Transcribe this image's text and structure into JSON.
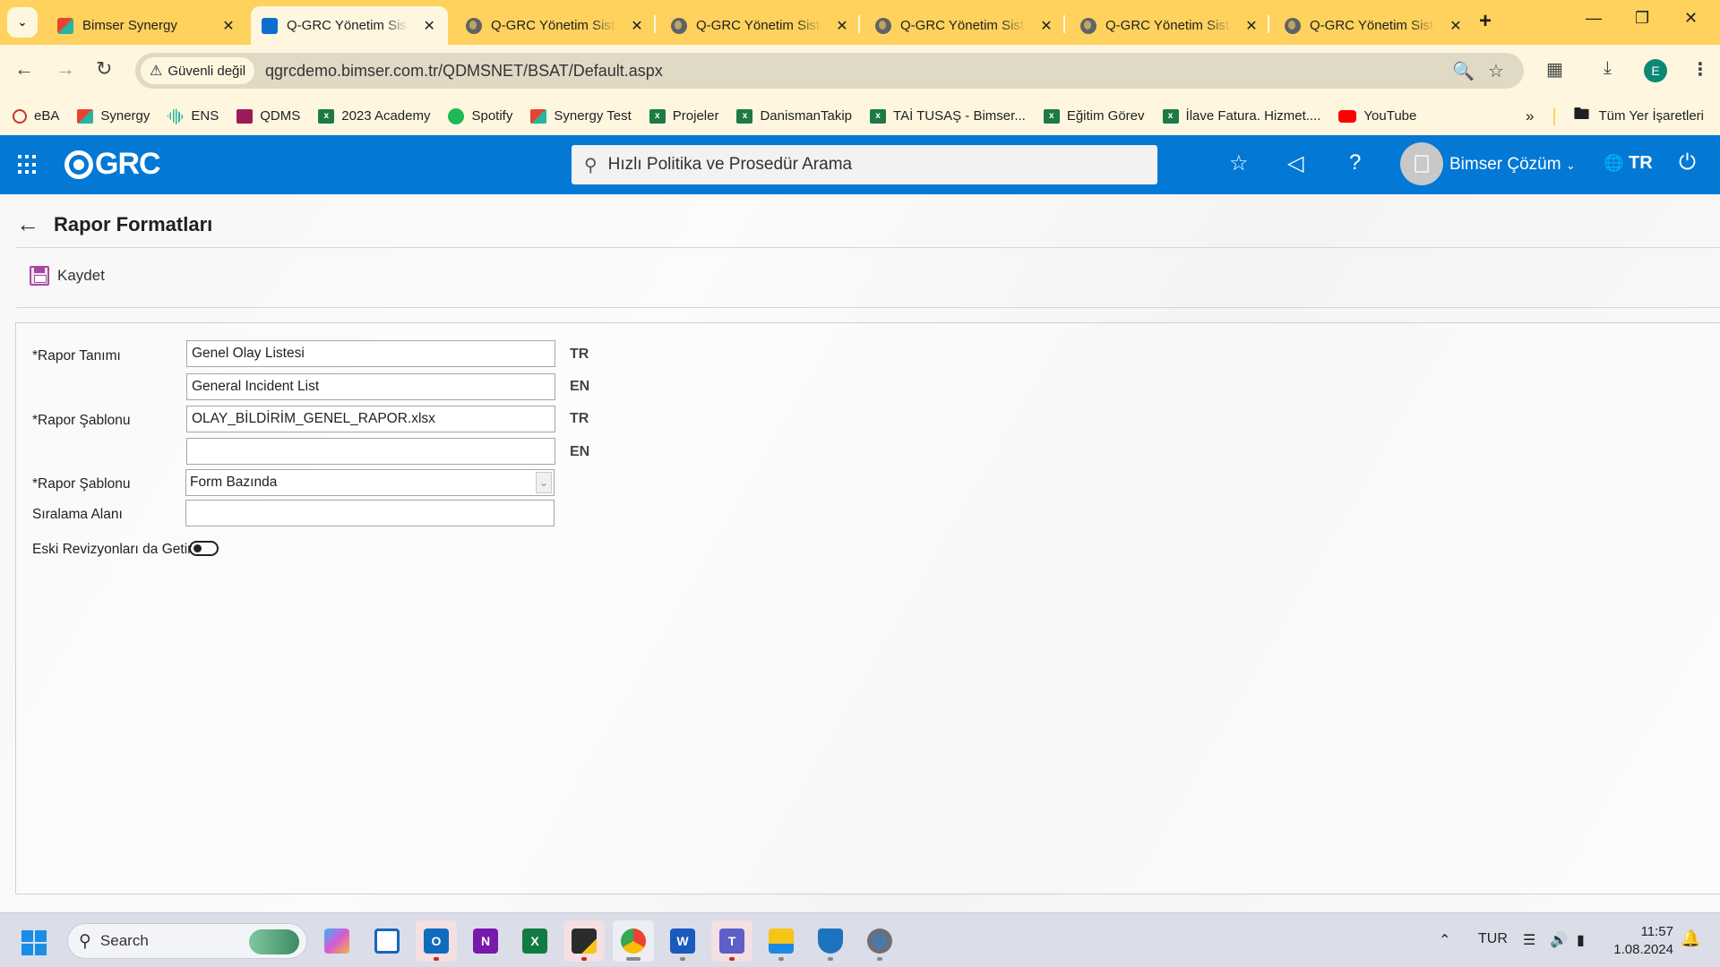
{
  "browser": {
    "tabs": [
      {
        "title": "Bimser Synergy",
        "active": false,
        "icon": "synergy-icon"
      },
      {
        "title": "Q-GRC Yönetim Sistemi",
        "active": true,
        "icon": "qgrc-icon"
      },
      {
        "title": "Q-GRC Yönetim Sistemi",
        "active": false,
        "icon": "globe-icon"
      },
      {
        "title": "Q-GRC Yönetim Sistemi",
        "active": false,
        "icon": "globe-icon"
      },
      {
        "title": "Q-GRC Yönetim Sistemi",
        "active": false,
        "icon": "globe-icon"
      },
      {
        "title": "Q-GRC Yönetim Sistemi",
        "active": false,
        "icon": "globe-icon"
      },
      {
        "title": "Q-GRC Yönetim Sistemi",
        "active": false,
        "icon": "globe-icon"
      }
    ],
    "security_chip": "Güvenli değil",
    "url": "qgrcdemo.bimser.com.tr/QDMSNET/BSAT/Default.aspx",
    "profile_initial": "E",
    "bookmarks": [
      {
        "label": "eBA",
        "icon": "eba-icon"
      },
      {
        "label": "Synergy",
        "icon": "synergy-icon"
      },
      {
        "label": "ENS",
        "icon": "ens-icon"
      },
      {
        "label": "QDMS",
        "icon": "qdms-icon"
      },
      {
        "label": "2023 Academy",
        "icon": "excel-icon"
      },
      {
        "label": "Spotify",
        "icon": "spotify-icon"
      },
      {
        "label": "Synergy Test",
        "icon": "synergy-icon"
      },
      {
        "label": "Projeler",
        "icon": "excel-icon"
      },
      {
        "label": "DanismanTakip",
        "icon": "excel-icon"
      },
      {
        "label": "TAİ TUSAŞ - Bimser...",
        "icon": "excel-icon"
      },
      {
        "label": "Eğitim Görev",
        "icon": "excel-icon"
      },
      {
        "label": "İlave Fatura. Hizmet....",
        "icon": "excel-icon"
      },
      {
        "label": "YouTube",
        "icon": "youtube-icon"
      }
    ],
    "all_bookmarks_label": "Tüm Yer İşaretleri"
  },
  "app": {
    "logo": "GRC",
    "search_placeholder": "Hızlı Politika ve Prosedür Arama",
    "user_name": "Bimser Çözüm",
    "language": "TR"
  },
  "page": {
    "title": "Rapor Formatları",
    "save_label": "Kaydet",
    "form": {
      "report_def_label": "*Rapor Tanımı",
      "report_def_tr": "Genel Olay Listesi",
      "report_def_en": "General Incident List",
      "report_template_label": "*Rapor Şablonu",
      "report_template_tr": "OLAY_BİLDİRİM_GENEL_RAPOR.xlsx",
      "report_template_en": "",
      "report_type_label": "*Rapor Şablonu",
      "report_type_value": "Form Bazında",
      "sort_field_label": "Sıralama Alanı",
      "sort_field_value": "",
      "old_revisions_label": "Eski Revizyonları da Getir",
      "old_revisions_on": false,
      "tag_tr": "TR",
      "tag_en": "EN"
    }
  },
  "taskbar": {
    "search_label": "Search",
    "language": "TUR",
    "time": "11:57",
    "date": "1.08.2024"
  },
  "colors": {
    "tabstrip": "#ffd25e",
    "app_header": "#0378d4",
    "save_icon": "#a54aa0"
  }
}
